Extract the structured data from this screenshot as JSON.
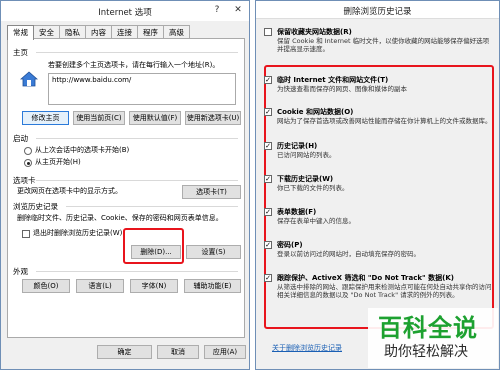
{
  "left_window": {
    "title": "Internet 选项",
    "help_glyph": "?",
    "close_glyph": "✕",
    "tabs": [
      "常规",
      "安全",
      "隐私",
      "内容",
      "连接",
      "程序",
      "高级"
    ],
    "homepage": {
      "section_label": "主页",
      "description": "若要创建多个主页选项卡，请在每行输入一个地址(R)。",
      "url": "http://www.baidu.com/",
      "buttons": [
        "修改主页",
        "使用当前页(C)",
        "使用默认值(F)",
        "使用新选项卡(U)"
      ]
    },
    "startup": {
      "section_label": "启动",
      "options": [
        "从上次会话中的选项卡开始(B)",
        "从主页开始(H)"
      ],
      "selected_index": 1
    },
    "tabs_section": {
      "section_label": "选项卡",
      "description": "更改网页在选项卡中的显示方式。",
      "button": "选项卡(T)"
    },
    "history": {
      "section_label": "浏览历史记录",
      "description": "删除临时文件、历史记录、Cookie、保存的密码和网页表单信息。",
      "checkbox_label": "退出时删除浏览历史记录(W)",
      "checkbox_checked": false,
      "delete_button": "删除(D)...",
      "settings_button": "设置(S)"
    },
    "appearance": {
      "section_label": "外观",
      "buttons": [
        "颜色(O)",
        "语言(L)",
        "字体(N)",
        "辅助功能(E)"
      ]
    },
    "footer_buttons": [
      "确定",
      "取消",
      "应用(A)"
    ]
  },
  "right_window": {
    "title": "删除浏览历史记录",
    "items": [
      {
        "title": "保留收藏夹网站数据(R)",
        "desc": "保留 Cookie 和 Internet 临时文件，以使你收藏的网站能够保存偏好选项并提高显示速度。",
        "checked": false
      },
      {
        "title": "临时 Internet 文件和网站文件(T)",
        "desc": "为快速查看而保存的网页、图像和媒体的副本",
        "checked": true
      },
      {
        "title": "Cookie 和网站数据(O)",
        "desc": "网站为了保存首选项或改善网站性能而存储在你计算机上的文件或数据库。",
        "checked": true
      },
      {
        "title": "历史记录(H)",
        "desc": "已访问网站的列表。",
        "checked": true
      },
      {
        "title": "下载历史记录(W)",
        "desc": "你已下载的文件的列表。",
        "checked": true
      },
      {
        "title": "表单数据(F)",
        "desc": "保存在表单中键入的信息。",
        "checked": true
      },
      {
        "title": "密码(P)",
        "desc": "登录以前访问过的网站时，自动填充保存的密码。",
        "checked": true
      },
      {
        "title": "跟踪保护、ActiveX 筛选和 \"Do Not Track\" 数据(K)",
        "desc": "从筛选中排除的网站、跟踪保护用来检测站点可能在何处自动共享你的访问相关详细信息的数据以及 \"Do Not Track\" 请求的例外的列表。",
        "checked": true
      }
    ],
    "about_link": "关于删除浏览历史记录"
  },
  "watermark": {
    "title": "百科全说",
    "subtitle": "助你轻松解决"
  },
  "colors": {
    "highlight": "#e8141c",
    "link": "#1a5fb4",
    "watermark_green": "#1da130"
  }
}
